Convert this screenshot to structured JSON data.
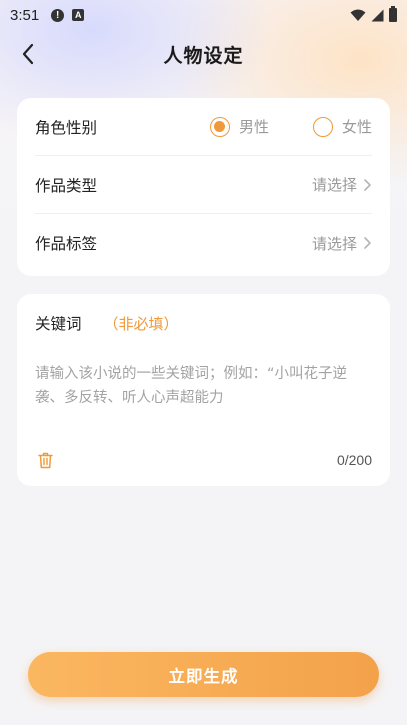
{
  "status_bar": {
    "time": "3:51",
    "icons": [
      "alert-icon",
      "font-a-icon",
      "wifi-icon",
      "signal-icon",
      "battery-icon"
    ]
  },
  "header": {
    "title": "人物设定",
    "back_icon": "chevron-left-icon"
  },
  "settings": {
    "gender": {
      "label": "角色性别",
      "options": [
        {
          "label": "男性",
          "selected": true
        },
        {
          "label": "女性",
          "selected": false
        }
      ]
    },
    "work_type": {
      "label": "作品类型",
      "value": "请选择"
    },
    "work_tags": {
      "label": "作品标签",
      "value": "请选择"
    }
  },
  "keywords": {
    "title": "关键词",
    "optional": "（非必填）",
    "placeholder": "请输入该小说的一些关键词；例如：“小叫花子逆袭、多反转、听人心声超能力",
    "counter": "0/200"
  },
  "actions": {
    "generate_label": "立即生成"
  },
  "colors": {
    "accent": "#f0993a",
    "button_start": "#fbb760",
    "button_end": "#f3a24a"
  }
}
